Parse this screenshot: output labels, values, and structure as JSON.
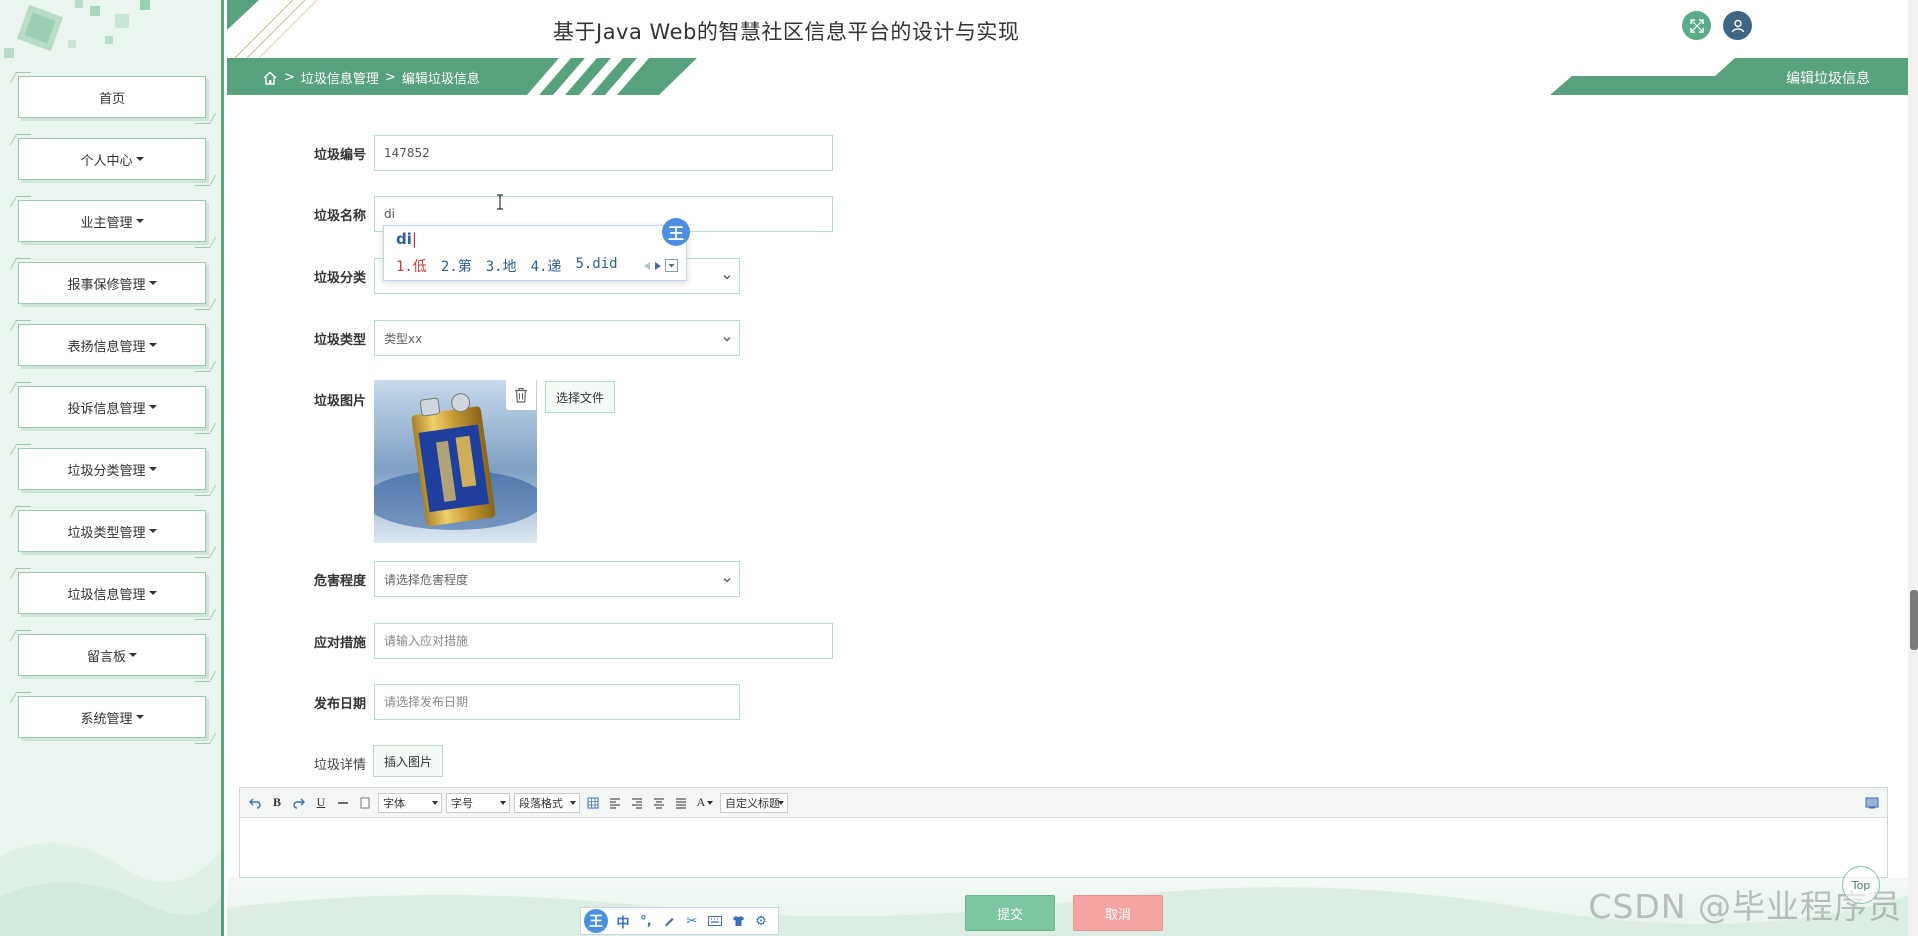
{
  "colors": {
    "brand_green": "#57a27c",
    "light_green_bg": "#eaf5ef",
    "submit": "#7ec5a1",
    "cancel": "#f5a3a3",
    "user_avatar": "#3f6585"
  },
  "header": {
    "title": "基于Java Web的智慧社区信息平台的设计与实现"
  },
  "breadcrumb": {
    "items": [
      "垃圾信息管理",
      "编辑垃圾信息"
    ]
  },
  "page_tag": "编辑垃圾信息",
  "sidebar": {
    "items": [
      {
        "label": "首页",
        "dropdown": false
      },
      {
        "label": "个人中心",
        "dropdown": true
      },
      {
        "label": "业主管理",
        "dropdown": true
      },
      {
        "label": "报事保修管理",
        "dropdown": true
      },
      {
        "label": "表扬信息管理",
        "dropdown": true
      },
      {
        "label": "投诉信息管理",
        "dropdown": true
      },
      {
        "label": "垃圾分类管理",
        "dropdown": true
      },
      {
        "label": "垃圾类型管理",
        "dropdown": true
      },
      {
        "label": "垃圾信息管理",
        "dropdown": true
      },
      {
        "label": "留言板",
        "dropdown": true
      },
      {
        "label": "系统管理",
        "dropdown": true
      }
    ]
  },
  "form": {
    "number": {
      "label": "垃圾编号",
      "value": "147852"
    },
    "name": {
      "label": "垃圾名称",
      "value": "di"
    },
    "category": {
      "label": "垃圾分类"
    },
    "type": {
      "label": "垃圾类型",
      "value": "类型xx"
    },
    "image": {
      "label": "垃圾图片",
      "choose_label": "选择文件"
    },
    "hazard": {
      "label": "危害程度",
      "placeholder": "请选择危害程度"
    },
    "measures": {
      "label": "应对措施",
      "placeholder": "请输入应对措施"
    },
    "date": {
      "label": "发布日期",
      "placeholder": "请选择发布日期"
    },
    "detail": {
      "label": "垃圾详情",
      "insert_label": "插入图片"
    }
  },
  "ime": {
    "composition": "di",
    "candidates": [
      "1.低",
      "2.第",
      "3.地",
      "4.递",
      "5.did"
    ],
    "badge": "王"
  },
  "editor": {
    "font_label": "字体",
    "size_label": "字号",
    "para_label": "段落格式",
    "custom_label": "自定义标题"
  },
  "actions": {
    "submit": "提交",
    "cancel": "取消",
    "top": "Top"
  },
  "ime_bar": {
    "logo": "王",
    "mode": "中"
  },
  "watermark": "CSDN @毕业程序员"
}
